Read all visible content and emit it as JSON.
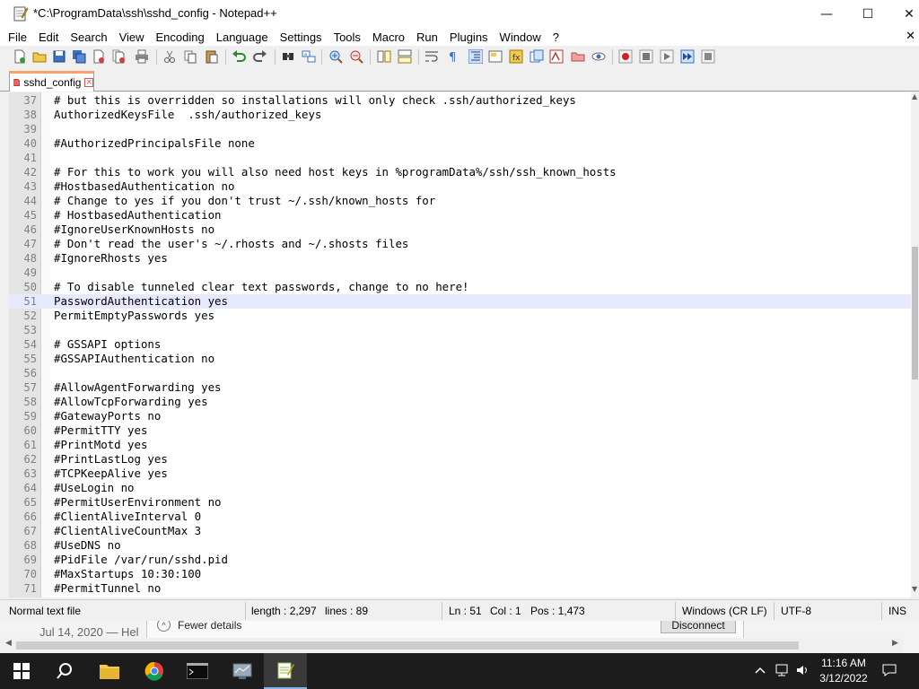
{
  "window": {
    "title": "*C:\\ProgramData\\ssh\\sshd_config - Notepad++",
    "minimize_glyph": "—",
    "maximize_glyph": "☐",
    "close_glyph": "✕"
  },
  "menu": {
    "items": [
      "File",
      "Edit",
      "Search",
      "View",
      "Encoding",
      "Language",
      "Settings",
      "Tools",
      "Macro",
      "Run",
      "Plugins",
      "Window",
      "?"
    ],
    "close_glyph": "✕"
  },
  "tab": {
    "label": "sshd_config",
    "close_glyph": "×"
  },
  "editor": {
    "current_line": 51,
    "lines": [
      {
        "n": "37",
        "text": "# but this is overridden so installations will only check .ssh/authorized_keys"
      },
      {
        "n": "38",
        "text": "AuthorizedKeysFile  .ssh/authorized_keys"
      },
      {
        "n": "39",
        "text": ""
      },
      {
        "n": "40",
        "text": "#AuthorizedPrincipalsFile none"
      },
      {
        "n": "41",
        "text": ""
      },
      {
        "n": "42",
        "text": "# For this to work you will also need host keys in %programData%/ssh/ssh_known_hosts"
      },
      {
        "n": "43",
        "text": "#HostbasedAuthentication no"
      },
      {
        "n": "44",
        "text": "# Change to yes if you don't trust ~/.ssh/known_hosts for"
      },
      {
        "n": "45",
        "text": "# HostbasedAuthentication"
      },
      {
        "n": "46",
        "text": "#IgnoreUserKnownHosts no"
      },
      {
        "n": "47",
        "text": "# Don't read the user's ~/.rhosts and ~/.shosts files"
      },
      {
        "n": "48",
        "text": "#IgnoreRhosts yes"
      },
      {
        "n": "49",
        "text": ""
      },
      {
        "n": "50",
        "text": "# To disable tunneled clear text passwords, change to no here!"
      },
      {
        "n": "51",
        "text": "PasswordAuthentication yes"
      },
      {
        "n": "52",
        "text": "PermitEmptyPasswords yes"
      },
      {
        "n": "53",
        "text": ""
      },
      {
        "n": "54",
        "text": "# GSSAPI options"
      },
      {
        "n": "55",
        "text": "#GSSAPIAuthentication no"
      },
      {
        "n": "56",
        "text": ""
      },
      {
        "n": "57",
        "text": "#AllowAgentForwarding yes"
      },
      {
        "n": "58",
        "text": "#AllowTcpForwarding yes"
      },
      {
        "n": "59",
        "text": "#GatewayPorts no"
      },
      {
        "n": "60",
        "text": "#PermitTTY yes"
      },
      {
        "n": "61",
        "text": "#PrintMotd yes"
      },
      {
        "n": "62",
        "text": "#PrintLastLog yes"
      },
      {
        "n": "63",
        "text": "#TCPKeepAlive yes"
      },
      {
        "n": "64",
        "text": "#UseLogin no"
      },
      {
        "n": "65",
        "text": "#PermitUserEnvironment no"
      },
      {
        "n": "66",
        "text": "#ClientAliveInterval 0"
      },
      {
        "n": "67",
        "text": "#ClientAliveCountMax 3"
      },
      {
        "n": "68",
        "text": "#UseDNS no"
      },
      {
        "n": "69",
        "text": "#PidFile /var/run/sshd.pid"
      },
      {
        "n": "70",
        "text": "#MaxStartups 10:30:100"
      },
      {
        "n": "71",
        "text": "#PermitTunnel no"
      }
    ]
  },
  "statusbar": {
    "file_type": "Normal text file",
    "length": "length : 2,297",
    "lines": "lines : 89",
    "ln": "Ln : 51",
    "col": "Col : 1",
    "pos": "Pos : 1,473",
    "eol": "Windows (CR LF)",
    "encoding": "UTF-8",
    "mode": "INS"
  },
  "background": {
    "date_text": "Jul 14, 2020 — Hel",
    "fewer_details": "Fewer details",
    "disconnect": "Disconnect",
    "fewer_glyph": "^"
  },
  "taskbar": {
    "time": "11:16 AM",
    "date": "3/12/2022"
  },
  "colors": {
    "current_line": "#e8e8ff",
    "tab_accent": "#f9a36b",
    "taskbar": "#1c1c1c"
  }
}
